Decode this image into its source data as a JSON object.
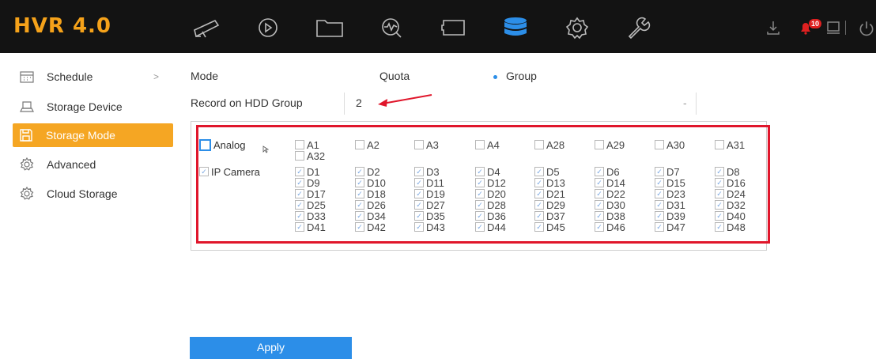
{
  "app": {
    "logo": "HVR 4.0",
    "alarm_count": "10"
  },
  "nav": [
    {
      "name": "live-view-icon"
    },
    {
      "name": "playback-icon"
    },
    {
      "name": "file-management-icon"
    },
    {
      "name": "smart-analysis-icon"
    },
    {
      "name": "configuration-icon"
    },
    {
      "name": "storage-icon",
      "active": true
    },
    {
      "name": "system-settings-icon"
    },
    {
      "name": "maintenance-icon"
    }
  ],
  "sidebar": {
    "items": [
      {
        "label": "Schedule",
        "icon": "calendar-icon",
        "chevron": ">"
      },
      {
        "label": "Storage Device",
        "icon": "hdd-icon"
      },
      {
        "label": "Storage Mode",
        "icon": "save-icon",
        "active": true
      },
      {
        "label": "Advanced",
        "icon": "gear-icon"
      },
      {
        "label": "Cloud Storage",
        "icon": "gear-icon"
      }
    ]
  },
  "form": {
    "mode_label": "Mode",
    "mode_options": [
      "Quota",
      "Group"
    ],
    "mode_selected": "Group",
    "record_label": "Record on HDD Group",
    "record_value": "2",
    "record_dropdown": "-",
    "analog_label": "Analog",
    "ip_camera_label": "IP Camera",
    "analog_channels": [
      "A1",
      "A2",
      "A3",
      "A4",
      "A28",
      "A29",
      "A30",
      "A31",
      "A32"
    ],
    "ip_channels": [
      "D1",
      "D2",
      "D3",
      "D4",
      "D5",
      "D6",
      "D7",
      "D8",
      "D9",
      "D10",
      "D11",
      "D12",
      "D13",
      "D14",
      "D15",
      "D16",
      "D17",
      "D18",
      "D19",
      "D20",
      "D21",
      "D22",
      "D23",
      "D24",
      "D25",
      "D26",
      "D27",
      "D28",
      "D29",
      "D30",
      "D31",
      "D32",
      "D33",
      "D34",
      "D35",
      "D36",
      "D37",
      "D38",
      "D39",
      "D40",
      "D41",
      "D42",
      "D43",
      "D44",
      "D45",
      "D46",
      "D47",
      "D48"
    ],
    "apply_label": "Apply"
  },
  "colors": {
    "accent": "#f5a623",
    "primary": "#2c8ee8",
    "highlight": "#e0162b",
    "topbar": "#131313"
  }
}
